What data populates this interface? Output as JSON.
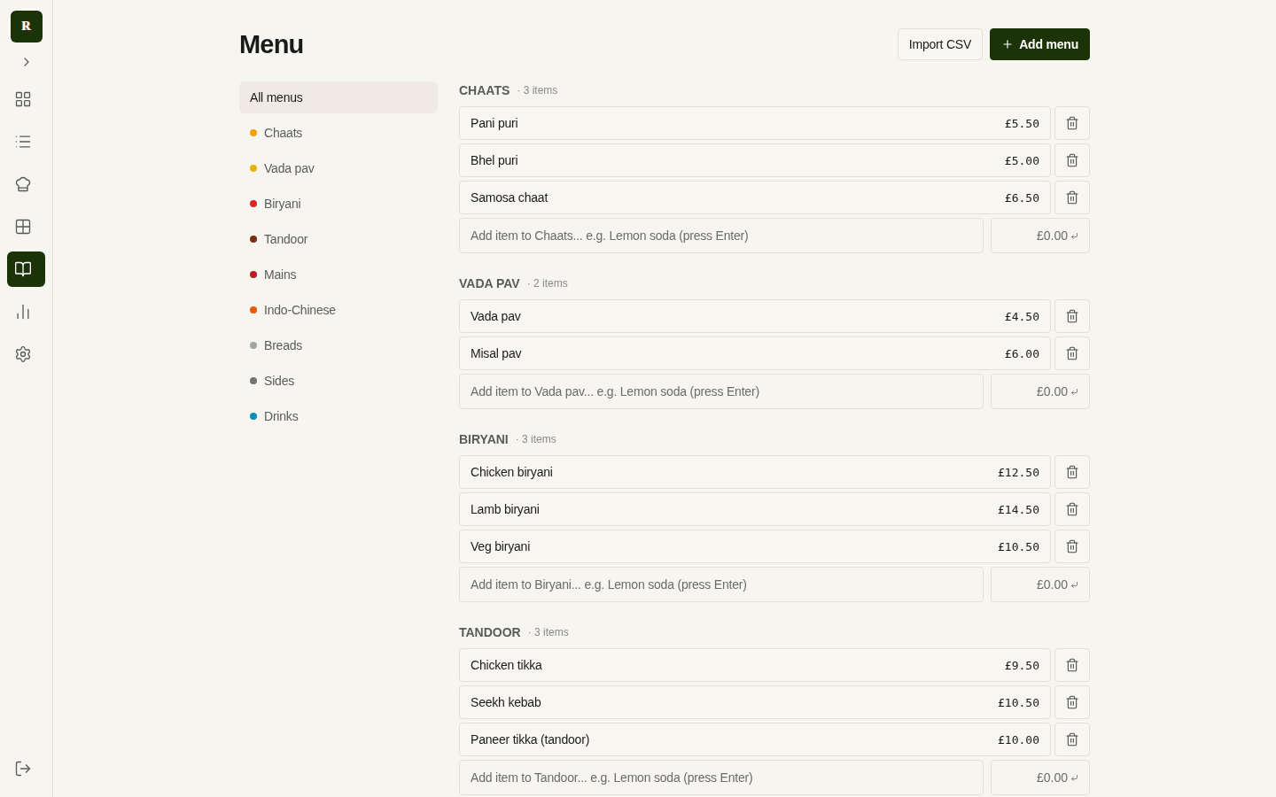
{
  "logo": "R",
  "nav": [
    {
      "kind": "grid",
      "selected": false
    },
    {
      "kind": "list",
      "selected": false
    },
    {
      "kind": "chef-hat",
      "selected": false
    },
    {
      "kind": "table",
      "selected": false
    },
    {
      "kind": "book",
      "selected": true
    },
    {
      "kind": "chart",
      "selected": false
    },
    {
      "kind": "settings",
      "selected": false
    }
  ],
  "page": {
    "title": "Menu",
    "buttons": [
      {
        "label": "Import CSV",
        "kind": "secondary"
      },
      {
        "label": "Add menu",
        "kind": "primary"
      }
    ]
  },
  "categories": [
    {
      "label": "All menus",
      "selected": true
    },
    {
      "label": "Chaats",
      "color": "#f59e0b",
      "selected": false
    },
    {
      "label": "Vada pav",
      "color": "#eab308",
      "selected": false
    },
    {
      "label": "Biryani",
      "color": "#dc2626",
      "selected": false
    },
    {
      "label": "Tandoor",
      "color": "#7c2d12",
      "selected": false
    },
    {
      "label": "Mains",
      "color": "#b91c1c",
      "selected": false
    },
    {
      "label": "Indo-Chinese",
      "color": "#ea580c",
      "selected": false
    },
    {
      "label": "Breads",
      "color": "#a3a3a3",
      "selected": false
    },
    {
      "label": "Sides",
      "color": "#737373",
      "selected": false
    },
    {
      "label": "Drinks",
      "color": "#0891b2",
      "selected": false
    }
  ],
  "sections": [
    {
      "title": "CHAATS",
      "count": "· 3 items",
      "items": [
        {
          "name": "Pani puri",
          "price": "£5.50"
        },
        {
          "name": "Bhel puri",
          "price": "£5.00"
        },
        {
          "name": "Samosa chaat",
          "price": "£6.50"
        }
      ],
      "add_item": {
        "placeholder": "Add item to Chaats... e.g. Lemon soda (press Enter)",
        "price_placeholder": "£0.00"
      }
    },
    {
      "title": "VADA PAV",
      "count": "· 2 items",
      "items": [
        {
          "name": "Vada pav",
          "price": "£4.50"
        },
        {
          "name": "Misal pav",
          "price": "£6.00"
        }
      ],
      "add_item": {
        "placeholder": "Add item to Vada pav... e.g. Lemon soda (press Enter)",
        "price_placeholder": "£0.00"
      }
    },
    {
      "title": "BIRYANI",
      "count": "· 3 items",
      "items": [
        {
          "name": "Chicken biryani",
          "price": "£12.50"
        },
        {
          "name": "Lamb biryani",
          "price": "£14.50"
        },
        {
          "name": "Veg biryani",
          "price": "£10.50"
        }
      ],
      "add_item": {
        "placeholder": "Add item to Biryani... e.g. Lemon soda (press Enter)",
        "price_placeholder": "£0.00"
      }
    },
    {
      "title": "TANDOOR",
      "count": "· 3 items",
      "items": [
        {
          "name": "Chicken tikka",
          "price": "£9.50"
        },
        {
          "name": "Seekh kebab",
          "price": "£10.50"
        },
        {
          "name": "Paneer tikka (tandoor)",
          "price": "£10.00"
        }
      ],
      "add_item": {
        "placeholder": "Add item to Tandoor... e.g. Lemon soda (press Enter)",
        "price_placeholder": "£0.00"
      }
    }
  ]
}
